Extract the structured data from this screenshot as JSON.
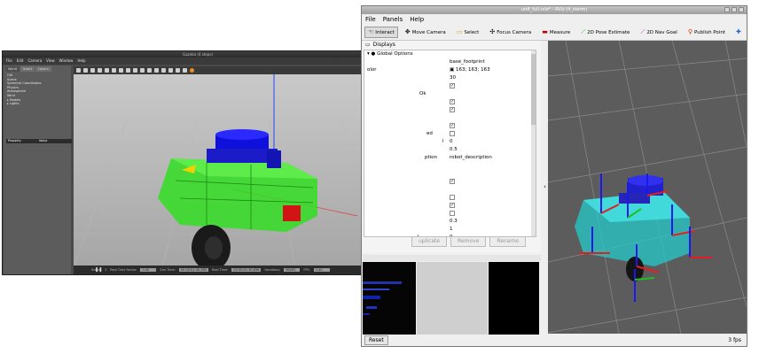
{
  "gazebo": {
    "title": "Gazebo (4 steps)",
    "menu": [
      "File",
      "Edit",
      "Camera",
      "View",
      "Window",
      "Help"
    ],
    "tabs": [
      "World",
      "Insert",
      "Layers"
    ],
    "tree": [
      "GUI",
      "Scene",
      "Spherical Coordinates",
      "Physics",
      "Atmosphere",
      "Wind",
      "Models",
      "Lights"
    ],
    "props_header": {
      "property": "Property",
      "value": "Value"
    },
    "status": {
      "steps_label": "Steps:",
      "steps_value": "1",
      "real_time_factor_label": "Real Time Factor:",
      "real_time_factor_value": "0.00",
      "sim_time_label": "Sim Time:",
      "sim_time_value": "00 00:01:30.283",
      "real_time_label": "Real Time:",
      "real_time_value": "00 00:01:30.836",
      "iterations_label": "Iterations:",
      "iterations_value": "90283",
      "fps_label": "FPS:",
      "fps_value": "1.40",
      "reset_time": "Reset Time"
    }
  },
  "rviz": {
    "title": "urdf_full.rviz* - RViz (4_sterm)",
    "menu": [
      "File",
      "Panels",
      "Help"
    ],
    "tools": [
      {
        "icon": "hand-icon",
        "label": "Interact"
      },
      {
        "icon": "move-camera-icon",
        "label": "Move Camera"
      },
      {
        "icon": "select-icon",
        "label": "Select"
      },
      {
        "icon": "focus-camera-icon",
        "label": "Focus Camera"
      },
      {
        "icon": "measure-icon",
        "label": "Measure"
      },
      {
        "icon": "pose-estimate-icon",
        "label": "2D Pose Estimate"
      },
      {
        "icon": "nav-goal-icon",
        "label": "2D Nav Goal"
      },
      {
        "icon": "publish-point-icon",
        "label": "Publish Point"
      }
    ],
    "displays_title": "Displays",
    "global_options": "Global Options",
    "rows": [
      {
        "label": "",
        "value": "base_footprint"
      },
      {
        "label": "olor",
        "value": "163; 163; 163"
      },
      {
        "label": "",
        "value": "30"
      },
      {
        "label": "",
        "value": "",
        "checked": true
      },
      {
        "label": "Ok",
        "value": ""
      },
      {
        "label": "",
        "value": "",
        "checked": true
      },
      {
        "label": "",
        "value": "",
        "checked": true
      },
      {
        "label": "",
        "value": ""
      },
      {
        "label": "",
        "value": "",
        "checked": true
      },
      {
        "label": "ed",
        "value": "",
        "checked": false
      },
      {
        "label": "l",
        "value": "0"
      },
      {
        "label": "",
        "value": "0.5"
      },
      {
        "label": "ption",
        "value": "robot_description"
      },
      {
        "label": "",
        "value": ""
      },
      {
        "label": "",
        "value": ""
      },
      {
        "label": "",
        "value": "",
        "checked": true
      },
      {
        "label": "",
        "value": ""
      },
      {
        "label": "",
        "value": "",
        "checked": false
      },
      {
        "label": "",
        "value": "",
        "checked": true
      },
      {
        "label": "",
        "value": "",
        "checked": false
      },
      {
        "label": "",
        "value": "0.3"
      },
      {
        "label": "",
        "value": "1"
      },
      {
        "label": "l",
        "value": "0"
      }
    ],
    "buttons": {
      "duplicate": "uplicate",
      "remove": "Remove",
      "rename": "Rename"
    },
    "reset": "Reset",
    "fps": "3 fps"
  },
  "colors": {
    "chassis": "#33dd22",
    "lidar": "#1010dd",
    "rviz_chassis": "#26c9c9",
    "grid_bg": "#5c5c5c"
  }
}
